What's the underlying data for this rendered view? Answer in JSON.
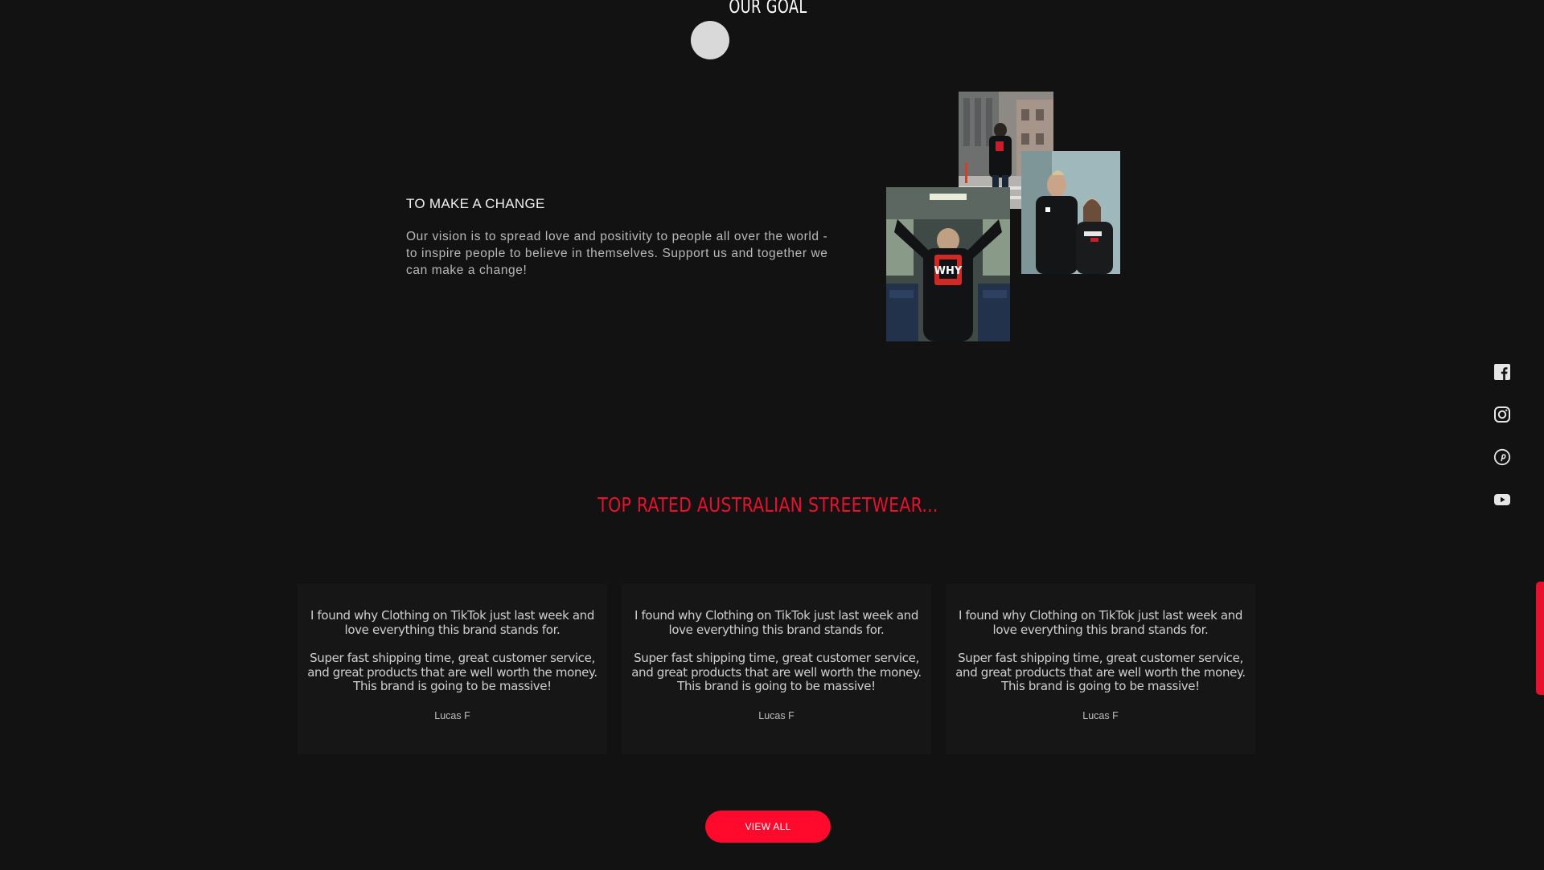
{
  "goal": {
    "title": "OUR GOAL",
    "heading": "TO MAKE A CHANGE",
    "body": "Our vision is to spread love and positivity to people all over the world - to inspire people to believe in themselves. Support us and together we can make a change!"
  },
  "socials": [
    {
      "name": "facebook-icon"
    },
    {
      "name": "instagram-icon"
    },
    {
      "name": "pinterest-icon"
    },
    {
      "name": "youtube-icon"
    }
  ],
  "reviews_section": {
    "title": "TOP RATED AUSTRALIAN STREETWEAR...",
    "reviews": [
      {
        "p1": "I found why Clothing on TikTok just last week and love everything this brand stands for.",
        "p2": "Super fast shipping time, great customer service, and great products that are well worth the money. This brand is going to be massive!",
        "author": "Lucas F"
      },
      {
        "p1": "I found why Clothing on TikTok just last week and love everything this brand stands for.",
        "p2": "Super fast shipping time, great customer service, and great products that are well worth the money. This brand is going to be massive!",
        "author": "Lucas F"
      },
      {
        "p1": "I found why Clothing on TikTok just last week and love everything this brand stands for.",
        "p2": "Super fast shipping time, great customer service, and great products that are well worth the money. This brand is going to be massive!",
        "author": "Lucas F"
      }
    ],
    "view_all_label": "VIEW ALL"
  },
  "colors": {
    "background": "#121213",
    "accent_red": "#e8112d",
    "button_red": "#ff0a2d",
    "card_bg": "#161617"
  }
}
